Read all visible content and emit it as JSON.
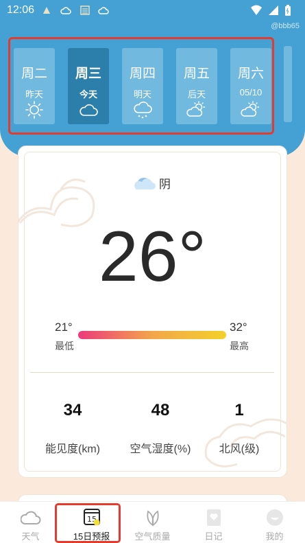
{
  "status_bar": {
    "time": "12:06",
    "watermark": "@bbb65"
  },
  "days": [
    {
      "name": "周二",
      "sub": "昨天",
      "icon": "sun-icon",
      "active": false
    },
    {
      "name": "周三",
      "sub": "今天",
      "icon": "cloud-icon",
      "active": true
    },
    {
      "name": "周四",
      "sub": "明天",
      "icon": "rain-cloud-icon",
      "active": false
    },
    {
      "name": "周五",
      "sub": "后天",
      "icon": "partly-cloudy-icon",
      "active": false
    },
    {
      "name": "周六",
      "sub": "05/10",
      "icon": "partly-cloudy-icon",
      "active": false
    }
  ],
  "current": {
    "condition": "阴",
    "condition_icon": "cloud-icon",
    "temperature": "26°",
    "low": "21°",
    "low_label": "最低",
    "high": "32°",
    "high_label": "最高"
  },
  "stats": [
    {
      "value": "34",
      "label": "能见度(km)"
    },
    {
      "value": "48",
      "label": "空气湿度(%)"
    },
    {
      "value": "1",
      "label": "北风(级)"
    }
  ],
  "tabs": [
    {
      "label": "天气",
      "icon": "weather-cloud-icon",
      "active": false
    },
    {
      "label": "15日预报",
      "icon": "calendar-15-icon",
      "active": true
    },
    {
      "label": "空气质量",
      "icon": "leaf-icon",
      "active": false
    },
    {
      "label": "日记",
      "icon": "diary-icon",
      "active": false
    },
    {
      "label": "我的",
      "icon": "profile-icon",
      "active": false
    }
  ],
  "colors": {
    "header_blue": "#45a1d3",
    "active_day": "#2d7fab",
    "highlight_red": "#e53b2f",
    "background": "#fbe9dc"
  }
}
